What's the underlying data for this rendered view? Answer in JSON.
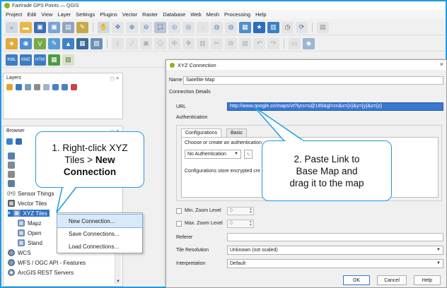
{
  "app": {
    "title": "Fairtrade GPS Points — QGIS"
  },
  "menubar": [
    "Project",
    "Edit",
    "View",
    "Layer",
    "Settings",
    "Plugins",
    "Vector",
    "Raster",
    "Database",
    "Web",
    "Mesh",
    "Processing",
    "Help"
  ],
  "panels": {
    "layers_title": "Layers",
    "browser_title": "Browser",
    "browser_items": [
      {
        "label": "Sensor Things",
        "icon": "sensor-icon"
      },
      {
        "label": "Vector Tiles",
        "icon": "vector-tiles-icon"
      },
      {
        "label": "XYZ Tiles",
        "icon": "xyz-tiles-icon"
      },
      {
        "label": "Mapz",
        "icon": "grid-icon"
      },
      {
        "label": "Open",
        "icon": "grid-icon"
      },
      {
        "label": "Stand",
        "icon": "grid-icon"
      },
      {
        "label": "WCS",
        "icon": "wcs-icon"
      },
      {
        "label": "WFS / OGC API - Features",
        "icon": "wfs-icon"
      },
      {
        "label": "ArcGIS REST Servers",
        "icon": "arcgis-icon"
      }
    ]
  },
  "context_menu": [
    "New Connection...",
    "Save Connections...",
    "Load Connections..."
  ],
  "dialog": {
    "title": "XYZ Connection",
    "name_label": "Name",
    "name_value": "Satellite Map",
    "section_label": "Connection Details",
    "url_label": "URL",
    "url_value": "http://www.google.cn/maps/vt?lyrs=s@189&gl=cn&x={x}&y={y}&z={z}",
    "auth_label": "Authentication",
    "tabs": [
      "Configurations",
      "Basic"
    ],
    "choose_text": "Choose or create an authentication",
    "auth_select": "No Authentication",
    "store_text": "Configurations store encrypted cre",
    "min_zoom_label": "Min. Zoom Level",
    "min_zoom_value": "0",
    "max_zoom_label": "Max. Zoom Level",
    "max_zoom_value": "0",
    "referer_label": "Referer",
    "tile_res_label": "Tile Resolution",
    "tile_res_value": "Unknown (not scaled)",
    "interp_label": "Interpretation",
    "interp_value": "Default",
    "buttons": [
      "OK",
      "Cancel",
      "Help"
    ]
  },
  "callouts": {
    "step1_prefix": "1. Right-click XYZ",
    "step1_mid": "Tiles > ",
    "step1_bold1": "New",
    "step1_bold2": "Connection",
    "step2_line1": "2. Paste Link to",
    "step2_line2": "Base Map and",
    "step2_line3": "drag it to the map"
  },
  "colors": {
    "accent": "#1e9be0",
    "selection": "#2f73c2",
    "url_highlight": "#3a78d0"
  }
}
